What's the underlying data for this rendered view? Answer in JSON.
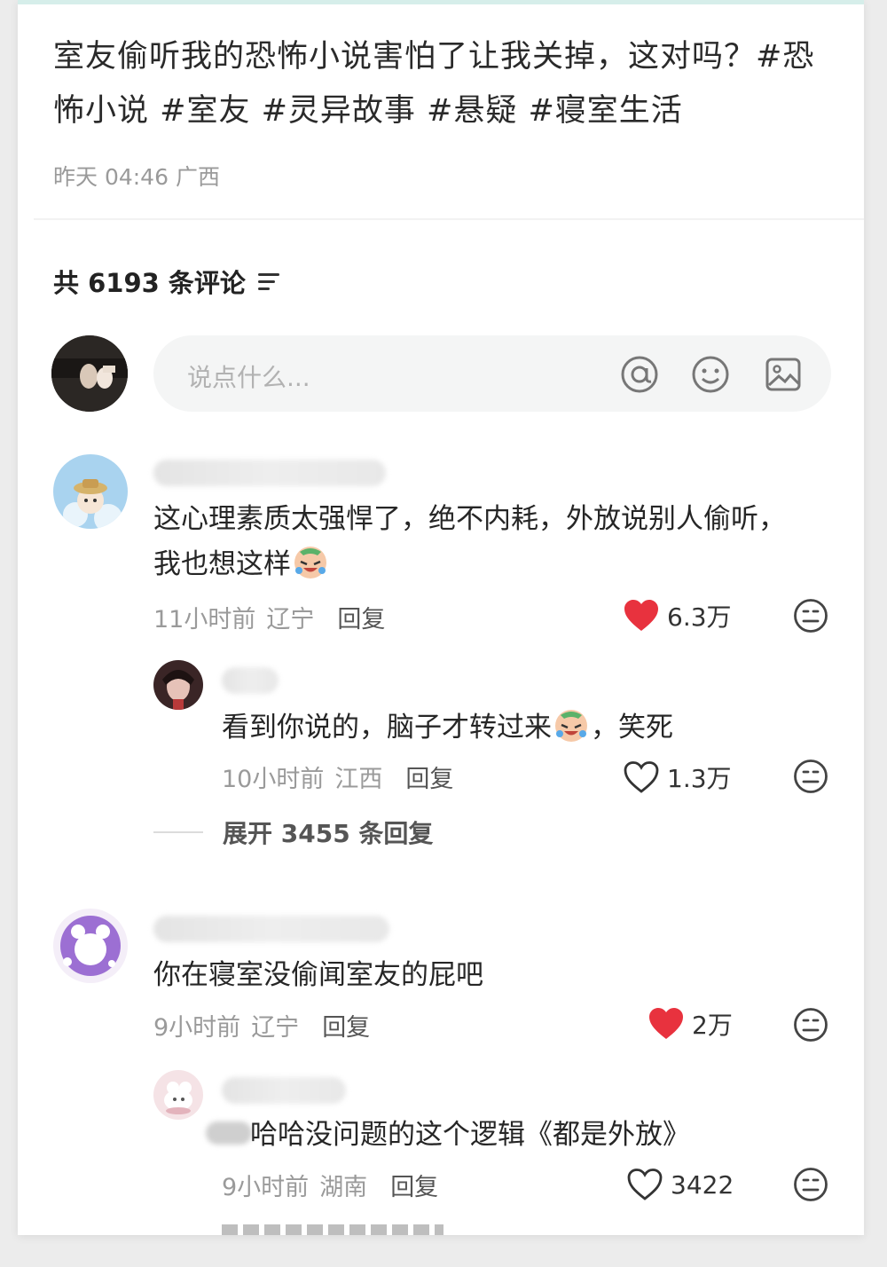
{
  "post": {
    "title": "室友偷听我的恐怖小说害怕了让我关掉，这对吗？#恐怖小说 #室友 #灵异故事 #悬疑 #寝室生活",
    "time": "昨天 04:46",
    "location": "广西"
  },
  "comments_header": {
    "label": "共 6193 条评论"
  },
  "input": {
    "placeholder": "说点什么..."
  },
  "comments": [
    {
      "text": "这心理素质太强悍了，绝不内耗，外放说别人偷听，",
      "text2": "我也想这样",
      "time": "11小时前",
      "location": "辽宁",
      "reply_label": "回复",
      "likes": "6.3万",
      "liked": true,
      "reply": {
        "text_a": "看到你说的，脑子才转过来",
        "text_b": "，笑死",
        "time": "10小时前",
        "location": "江西",
        "reply_label": "回复",
        "likes": "1.3万",
        "liked": false
      },
      "expand_label": "展开 3455 条回复"
    },
    {
      "text": "你在寝室没偷闻室友的屁吧",
      "time": "9小时前",
      "location": "辽宁",
      "reply_label": "回复",
      "likes": "2万",
      "liked": true,
      "reply": {
        "text": "哈哈没问题的这个逻辑《都是外放》",
        "time": "9小时前",
        "location": "湖南",
        "reply_label": "回复",
        "likes": "3422",
        "liked": false
      }
    }
  ],
  "colors": {
    "like_red": "#e8323e",
    "accent_bar": "#d6eeea"
  }
}
